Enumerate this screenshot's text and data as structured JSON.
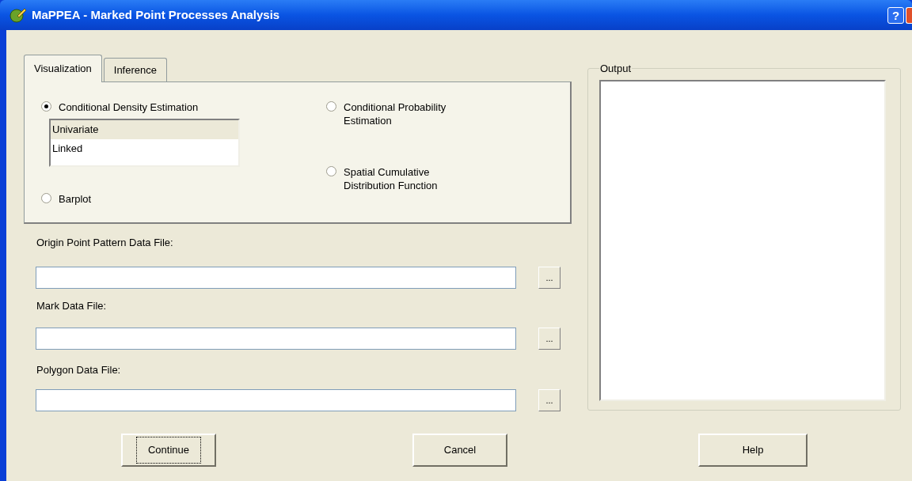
{
  "window": {
    "title": "MaPPEA - Marked Point Processes Analysis",
    "help": "?"
  },
  "tabs": [
    {
      "label": "Visualization",
      "selected": true
    },
    {
      "label": "Inference",
      "selected": false
    }
  ],
  "options": [
    {
      "label": "Conditional Density Estimation",
      "selected": true,
      "list": [
        {
          "label": "Univariate",
          "selected": true
        },
        {
          "label": "Linked",
          "selected": false
        }
      ]
    },
    {
      "label": "Conditional Probability Estimation",
      "selected": false
    },
    {
      "label": "Barplot",
      "selected": false
    },
    {
      "label": "Spatial Cumulative Distribution Function",
      "selected": false
    }
  ],
  "files": [
    {
      "label": "Origin Point Pattern Data File:",
      "browse": "..."
    },
    {
      "label": "Mark Data File:",
      "browse": "..."
    },
    {
      "label": "Polygon Data File:",
      "browse": "..."
    }
  ],
  "output": {
    "label": "Output"
  },
  "buttons": [
    {
      "label": "Continue",
      "focused": true
    },
    {
      "label": "Cancel",
      "focused": false
    },
    {
      "label": "Help",
      "focused": false
    }
  ]
}
